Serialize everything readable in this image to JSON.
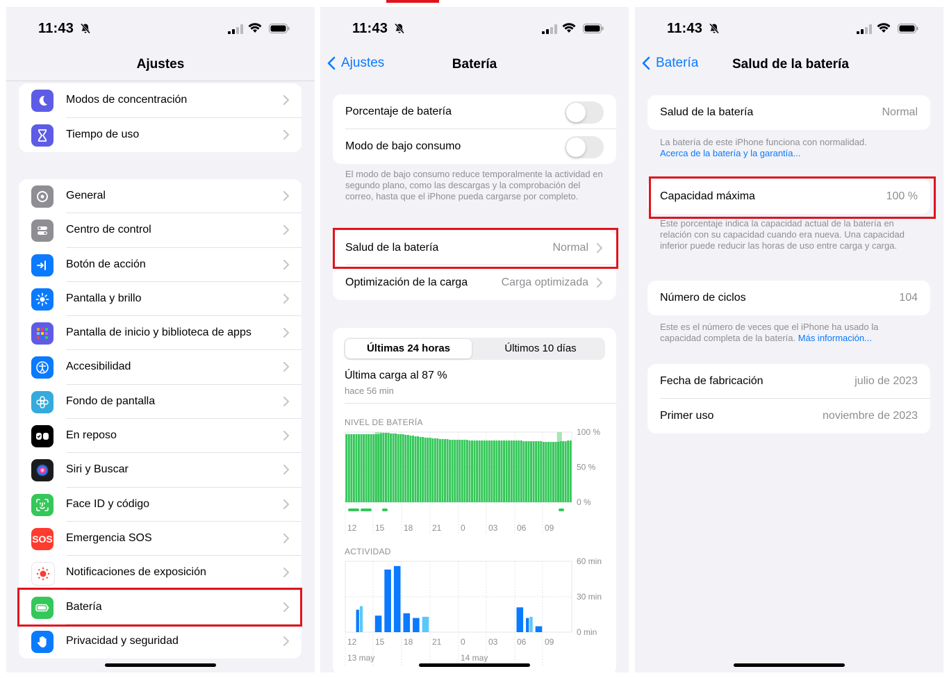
{
  "status": {
    "time": "11:43"
  },
  "settings": {
    "title": "Ajustes",
    "group1": [
      {
        "label": "Modos de concentración",
        "icon": "moon-icon",
        "color": "#5e5ce6"
      },
      {
        "label": "Tiempo de uso",
        "icon": "hourglass-icon",
        "color": "#5e5ce6"
      }
    ],
    "group2": [
      {
        "label": "General",
        "icon": "gear-icon",
        "color": "#8e8e93"
      },
      {
        "label": "Centro de control",
        "icon": "switches-icon",
        "color": "#8e8e93"
      },
      {
        "label": "Botón de acción",
        "icon": "action-button-icon",
        "color": "#0a7aff"
      },
      {
        "label": "Pantalla y brillo",
        "icon": "sun-icon",
        "color": "#0a7aff"
      },
      {
        "label": "Pantalla de inicio y biblioteca de apps",
        "icon": "app-grid-icon",
        "color": "#5e5ce6"
      },
      {
        "label": "Accesibilidad",
        "icon": "accessibility-icon",
        "color": "#0a7aff"
      },
      {
        "label": "Fondo de pantalla",
        "icon": "flower-icon",
        "color": "#35aadc"
      },
      {
        "label": "En reposo",
        "icon": "standby-icon",
        "color": "#000000"
      },
      {
        "label": "Siri y Buscar",
        "icon": "siri-icon",
        "color": "#1c1c1e"
      },
      {
        "label": "Face ID y código",
        "icon": "face-id-icon",
        "color": "#34c759"
      },
      {
        "label": "Emergencia SOS",
        "icon": "sos-icon",
        "color": "#ff3b30"
      },
      {
        "label": "Notificaciones de exposición",
        "icon": "exposure-icon",
        "color": "#ffffff"
      },
      {
        "label": "Batería",
        "icon": "battery-icon",
        "color": "#34c759"
      },
      {
        "label": "Privacidad y seguridad",
        "icon": "hand-icon",
        "color": "#0a7aff"
      }
    ],
    "sos_text": "SOS"
  },
  "battery": {
    "back": "Ajustes",
    "title": "Batería",
    "percentage_label": "Porcentaje de batería",
    "low_power_label": "Modo de bajo consumo",
    "low_power_note": "El modo de bajo consumo reduce temporalmente la actividad en segundo plano, como las descargas y la comprobación del correo, hasta que el iPhone pueda cargarse por completo.",
    "health_label": "Salud de la batería",
    "health_value": "Normal",
    "charging_label": "Optimización de la carga",
    "charging_value": "Carga optimizada",
    "seg_24h": "Últimas 24 horas",
    "seg_10d": "Últimos 10 días",
    "last_charge": "Última carga al 87 %",
    "last_charge_time": "hace 56 min",
    "level_header": "NIVEL DE BATERÍA",
    "activity_header": "ACTIVIDAD",
    "date1": "13 may",
    "date2": "14 may"
  },
  "chart_data": [
    {
      "type": "bar",
      "title": "NIVEL DE BATERÍA",
      "x_tick_labels": [
        "12",
        "15",
        "18",
        "21",
        "0",
        "03",
        "06",
        "09"
      ],
      "y_tick_labels": [
        "100 %",
        "50 %",
        "0 %"
      ],
      "ylim": [
        0,
        100
      ],
      "values": [
        97,
        97,
        97,
        97,
        97,
        97,
        97,
        97,
        97,
        97,
        97,
        97,
        97,
        97,
        98,
        99,
        99,
        99,
        98,
        98,
        98,
        97,
        97,
        97,
        96,
        96,
        95,
        95,
        94,
        94,
        93,
        93,
        92,
        92,
        92,
        91,
        91,
        91,
        90,
        90,
        90,
        90,
        89,
        89,
        89,
        89,
        89,
        89,
        89,
        89,
        88,
        88,
        88,
        88,
        88,
        88,
        88,
        88,
        88,
        88,
        88,
        88,
        88,
        88,
        88,
        88,
        88,
        88,
        88,
        88,
        88,
        88,
        87,
        87,
        87,
        87,
        87,
        87,
        87,
        87,
        86,
        86,
        86,
        86,
        86,
        86,
        86,
        87,
        87,
        87,
        88,
        88
      ],
      "charging_values": [
        0,
        0,
        0,
        0,
        0,
        0,
        0,
        0,
        0,
        0,
        0,
        0,
        100,
        100,
        100,
        0,
        0,
        0,
        0,
        0,
        0,
        0,
        0,
        0,
        0,
        0,
        0,
        0,
        0,
        0,
        0,
        0,
        0,
        0,
        0,
        0,
        0,
        0,
        0,
        0,
        0,
        0,
        0,
        0,
        0,
        0,
        0,
        0,
        0,
        0,
        0,
        0,
        0,
        0,
        0,
        0,
        0,
        0,
        0,
        0,
        0,
        0,
        0,
        0,
        0,
        0,
        0,
        0,
        0,
        0,
        0,
        0,
        0,
        0,
        0,
        0,
        0,
        0,
        0,
        0,
        0,
        0,
        0,
        0,
        0,
        0,
        100,
        100,
        0,
        0,
        0,
        0
      ],
      "colors": {
        "level": "#34c759",
        "charging": "#a7e4b3"
      }
    },
    {
      "type": "bar",
      "title": "ACTIVIDAD",
      "x_tick_labels": [
        "12",
        "15",
        "18",
        "21",
        "0",
        "03",
        "06",
        "09"
      ],
      "y_tick_labels": [
        "60 min",
        "30 min",
        "0 min"
      ],
      "ylim": [
        0,
        60
      ],
      "categories": [
        "12",
        "13",
        "14",
        "15",
        "16",
        "17",
        "18",
        "19",
        "20",
        "21",
        "22",
        "23",
        "0",
        "1",
        "2",
        "3",
        "4",
        "5",
        "6",
        "7",
        "8",
        "9",
        "10",
        "11"
      ],
      "series": [
        {
          "name": "screen_on",
          "values": [
            0,
            19,
            0,
            14,
            53,
            56,
            16,
            12,
            0,
            0,
            0,
            0,
            0,
            0,
            0,
            0,
            0,
            0,
            21,
            12,
            5,
            0,
            0,
            0
          ]
        },
        {
          "name": "screen_off",
          "values": [
            0,
            22,
            0,
            0,
            0,
            0,
            0,
            0,
            13,
            0,
            0,
            0,
            0,
            0,
            0,
            0,
            0,
            0,
            0,
            13,
            0,
            0,
            0,
            0
          ]
        }
      ],
      "colors": {
        "screen_on": "#0a7aff",
        "screen_off": "#5ac8fa"
      }
    }
  ],
  "health": {
    "back": "Batería",
    "title": "Salud de la batería",
    "health_label": "Salud de la batería",
    "health_value": "Normal",
    "health_note": "La batería de este iPhone funciona con normalidad.",
    "health_link": "Acerca de la batería y la garantía...",
    "capacity_label": "Capacidad máxima",
    "capacity_value": "100 %",
    "capacity_note": "Este porcentaje indica la capacidad actual de la batería en relación con su capacidad cuando era nueva. Una capacidad inferior puede reducir las horas de uso entre carga y carga.",
    "cycles_label": "Número de ciclos",
    "cycles_value": "104",
    "cycles_note": "Este es el número de veces que el iPhone ha usado la capacidad completa de la batería.",
    "cycles_link": "Más información...",
    "manufacture_label": "Fecha de fabricación",
    "manufacture_value": "julio de 2023",
    "first_use_label": "Primer uso",
    "first_use_value": "noviembre de 2023"
  }
}
